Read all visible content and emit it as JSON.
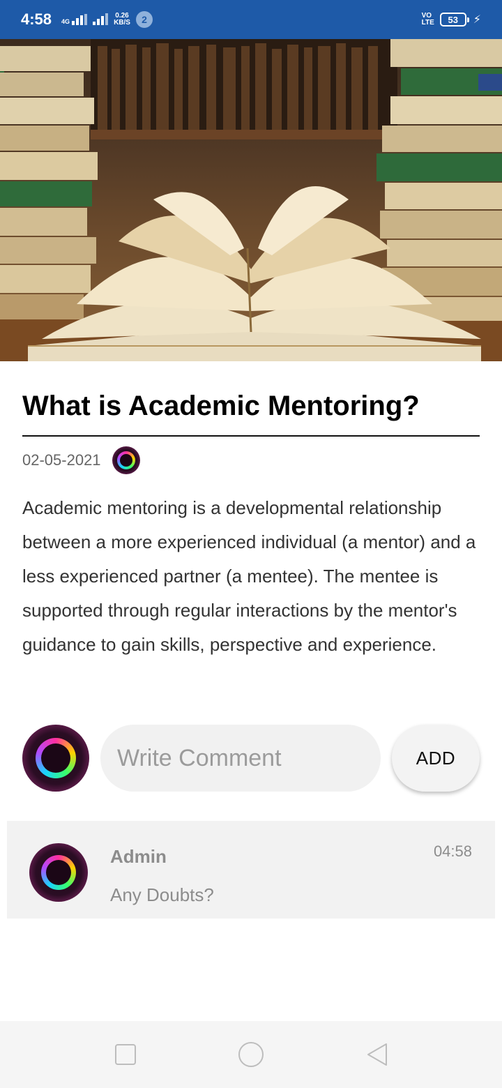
{
  "status_bar": {
    "time": "4:58",
    "network_label": "4G",
    "speed_value": "0.26",
    "speed_unit": "KB/S",
    "notification_count": "2",
    "volte_top": "VO",
    "volte_bottom": "LTE",
    "battery_level": "53",
    "color": "#1e5aa8"
  },
  "hero": {
    "icon": "open-books-photo"
  },
  "article": {
    "title": "What is Academic Mentoring?",
    "date": "02-05-2021",
    "body": "Academic mentoring is a developmental relationship between a more experienced individual (a mentor) and a less experienced partner (a mentee). The mentee is supported through regular interactions by the mentor's guidance to gain skills, perspective and experience."
  },
  "composer": {
    "placeholder": "Write Comment",
    "value": "",
    "add_label": "ADD"
  },
  "comments": [
    {
      "author": "Admin",
      "text": "Any Doubts?",
      "time": "04:58"
    }
  ],
  "nav": {
    "recents_icon": "square-icon",
    "home_icon": "circle-icon",
    "back_icon": "triangle-icon"
  }
}
